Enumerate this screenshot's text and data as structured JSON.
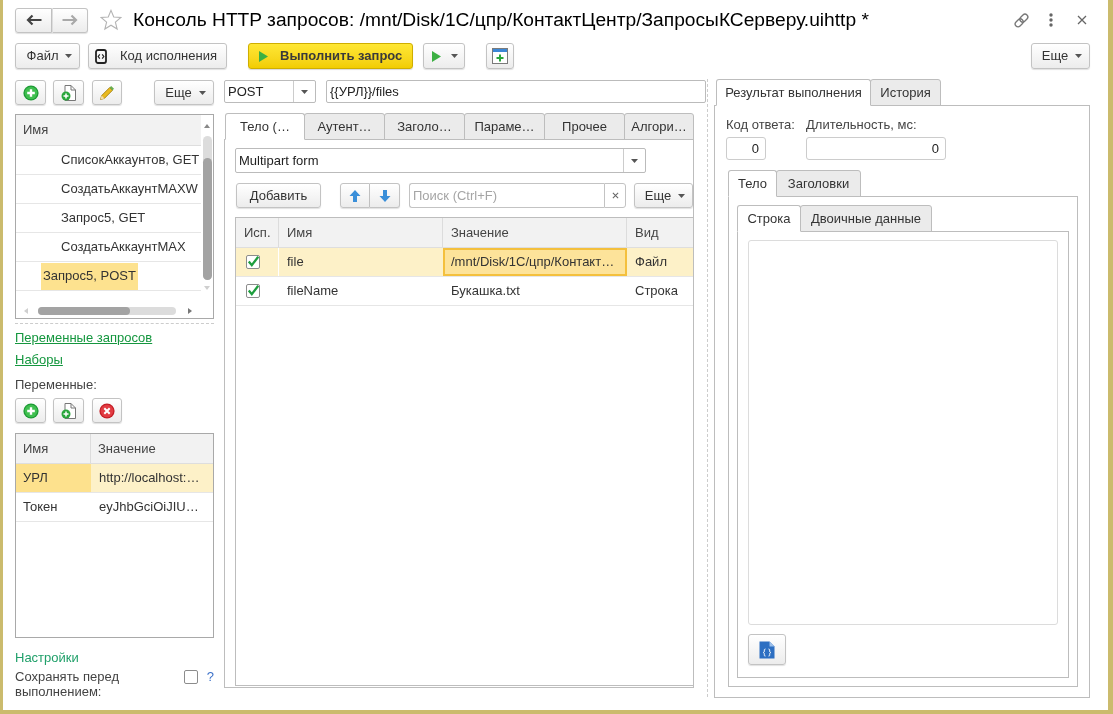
{
  "window": {
    "title": "Консоль HTTP запросов: /mnt/Disk/1C/цпр/КонтактЦентр/ЗапросыКСерверу.uihttp *",
    "favorite": false,
    "nav": [
      {
        "kind": "back",
        "disabled": false
      },
      {
        "kind": "forward",
        "disabled": true
      }
    ]
  },
  "toolbar": {
    "file_menu": "Файл",
    "code_button": "Код исполнения",
    "run_button": "Выполнить запрос",
    "more_button": "Еще"
  },
  "requests": {
    "more_button": "Еще",
    "column": "Имя",
    "items": [
      {
        "children": [
          {
            "label": "СписокАккаунтов, GET",
            "selected": false
          },
          {
            "label": "СоздатьАккаунтMAXW",
            "selected": false
          },
          {
            "label": "Запрос5, GET",
            "selected": false
          },
          {
            "label": "СоздатьАккаунтMAX",
            "selected": false
          }
        ]
      },
      {
        "label": "Запрос5, POST",
        "selected": true
      }
    ]
  },
  "links": [
    "Переменные запросов",
    "Наборы"
  ],
  "variables": {
    "label": "Переменные:",
    "columns": [
      "Имя",
      "Значение"
    ],
    "rows": [
      {
        "name": "УРЛ",
        "value": "http://localhost:…",
        "selected": true
      },
      {
        "name": "Токен",
        "value": "eyJhbGciOiJIU…",
        "selected": false
      }
    ]
  },
  "settings": {
    "title": "Настройки",
    "save_before_run": {
      "label": "Сохранять перед выполнением:",
      "checked": false,
      "help": "?"
    }
  },
  "request": {
    "method": "POST",
    "url": "{{УРЛ}}/files",
    "tabs": [
      {
        "label": "Тело (…",
        "selected": true
      },
      {
        "label": "Аутент…",
        "selected": false
      },
      {
        "label": "Заголо…",
        "selected": false
      },
      {
        "label": "Параме…",
        "selected": false
      },
      {
        "label": "Прочее",
        "selected": false
      },
      {
        "label": "Алгори…",
        "selected": false
      }
    ],
    "body_type": "Multipart form",
    "add_button": "Добавить",
    "search": {
      "placeholder": "Поиск (Ctrl+F)"
    },
    "more_button": "Еще",
    "table": {
      "columns": [
        "Исп.",
        "Имя",
        "Значение",
        "Вид"
      ],
      "rows": [
        {
          "used": true,
          "name": "file",
          "value": "/mnt/Disk/1C/цпр/Контакт…",
          "type": "Файл",
          "selected": true
        },
        {
          "used": true,
          "name": "fileName",
          "value": "Букашка.txt",
          "type": "Строка",
          "selected": false
        }
      ]
    }
  },
  "result": {
    "tabs": [
      {
        "label": "Результат выполнения",
        "selected": true
      },
      {
        "label": "История",
        "selected": false
      }
    ],
    "response_code": {
      "label": "Код ответа:",
      "value": "0"
    },
    "duration": {
      "label": "Длительность, мс:",
      "value": "0"
    },
    "body_tabs": [
      {
        "label": "Тело",
        "selected": true
      },
      {
        "label": "Заголовки",
        "selected": false
      }
    ],
    "format_tabs": [
      {
        "label": "Строка",
        "selected": true
      },
      {
        "label": "Двоичные данные",
        "selected": false
      }
    ]
  }
}
